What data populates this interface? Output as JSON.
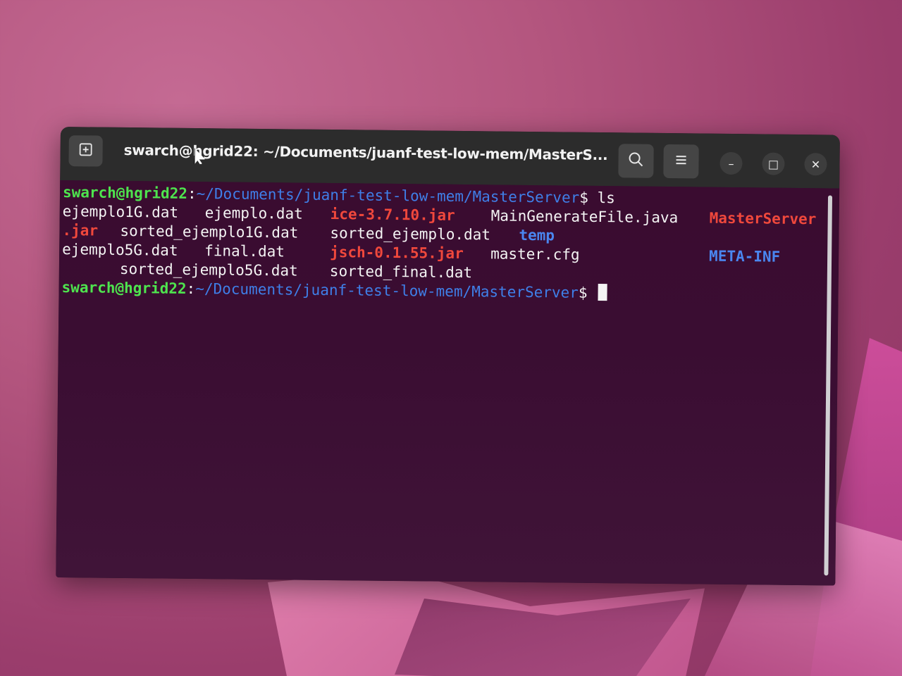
{
  "window": {
    "title": "swarch@hgrid22: ~/Documents/juanf-test-low-mem/MasterS..."
  },
  "titlebar": {
    "new_tab_icon": "new-tab-icon",
    "search_icon": "search-icon",
    "menu_icon": "hamburger-menu-icon",
    "minimize_icon": "minimize-icon",
    "maximize_icon": "maximize-icon",
    "close_icon": "close-icon",
    "minimize_glyph": "–",
    "maximize_glyph": "□",
    "close_glyph": "✕"
  },
  "terminal": {
    "prompt_user": "swarch@hgrid22",
    "prompt_colon": ":",
    "prompt_path": "~/Documents/juanf-test-low-mem/MasterServer",
    "prompt_symbol": "$",
    "command": " ls",
    "listing": {
      "row1": {
        "c1": "ejemplo1G.dat",
        "c2": "ejemplo.dat",
        "c3": "ice-3.7.10.jar",
        "c4": "MainGenerateFile.java",
        "c5": "MasterServer"
      },
      "row2": {
        "c1": ".jar",
        "c2": "sorted_ejemplo1G.dat",
        "c3": "sorted_ejemplo.dat",
        "c4": "temp"
      },
      "row3": {
        "c1": "ejemplo5G.dat",
        "c2": "final.dat",
        "c3": "jsch-0.1.55.jar",
        "c4": "master.cfg",
        "c5": "META-INF"
      },
      "row4": {
        "c2": "sorted_ejemplo5G.dat",
        "c3": "sorted_final.dat"
      }
    }
  },
  "colors": {
    "prompt_user": "#4ee44e",
    "prompt_path": "#3f7fe8",
    "archive": "#f0483c",
    "directory": "#4a86f0",
    "file": "#f4f4f4",
    "terminal_bg": "#3a0c30",
    "titlebar_bg": "#2c2c2c"
  }
}
